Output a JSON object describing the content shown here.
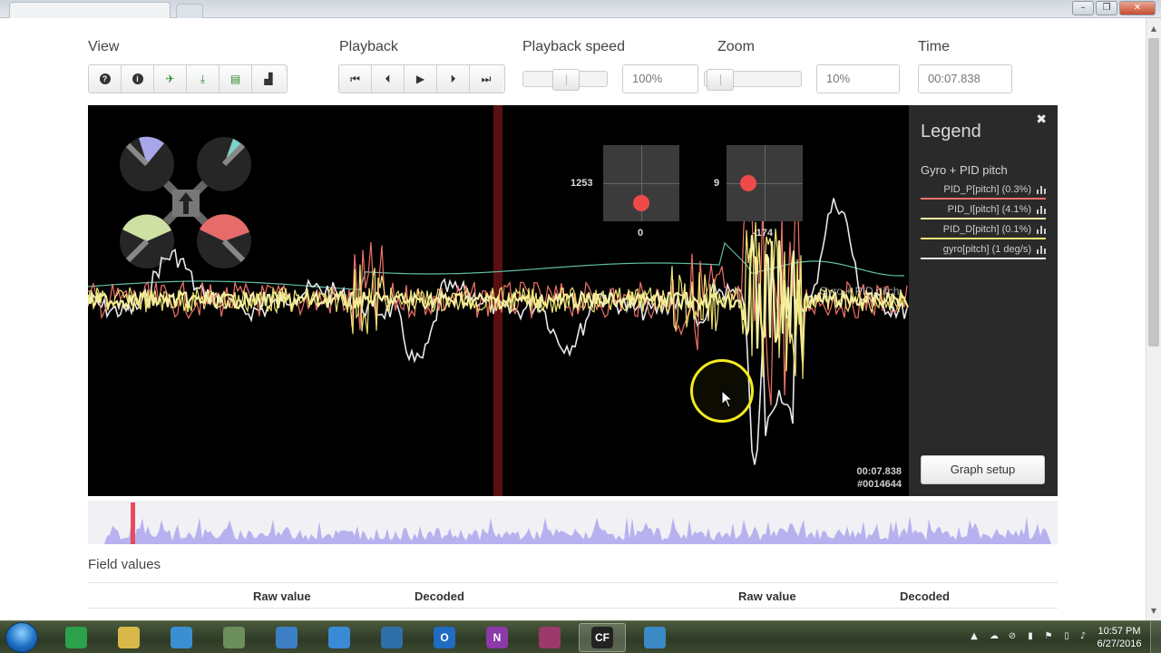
{
  "window": {
    "minimize_glyph": "–",
    "maximize_glyph": "❐",
    "close_glyph": "✕"
  },
  "toolbar": {
    "view_label": "View",
    "playback_label": "Playback",
    "playback_speed_label": "Playback speed",
    "zoom_label": "Zoom",
    "time_label": "Time",
    "view_buttons": [
      {
        "icon": "help-icon",
        "glyph": "?"
      },
      {
        "icon": "info-icon",
        "glyph": "i"
      },
      {
        "icon": "aircraft-icon",
        "glyph": "✈"
      },
      {
        "icon": "download-icon",
        "glyph": "⤓"
      },
      {
        "icon": "spreadsheet-icon",
        "glyph": "▤"
      },
      {
        "icon": "histogram-icon",
        "glyph": "▟"
      }
    ],
    "playback_buttons": [
      {
        "icon": "skip-start-icon",
        "glyph": "⏮"
      },
      {
        "icon": "step-back-icon",
        "glyph": "⏴"
      },
      {
        "icon": "play-icon",
        "glyph": "▶"
      },
      {
        "icon": "step-forward-icon",
        "glyph": "⏵"
      },
      {
        "icon": "skip-end-icon",
        "glyph": "⏭"
      }
    ],
    "playback_speed_value": "100%",
    "zoom_value": "10%",
    "time_value": "00:07.838"
  },
  "graph": {
    "stick_left": {
      "left_value": "1253",
      "bottom_value": "0"
    },
    "stick_right": {
      "left_value": "9",
      "bottom_value": "-174"
    },
    "series_label": "Gyro + PID pitch",
    "time_readout": "00:07.838",
    "frame_readout": "#0014644",
    "colors": {
      "pid_p": "#f07268",
      "pid_i": "#f6f0a8",
      "pid_d": "#f0e678",
      "gyro": "#e8e8ec",
      "setpoint": "#5fbfa8",
      "cursor_line": "#8a1414"
    }
  },
  "legend": {
    "title": "Legend",
    "close_glyph": "✖",
    "group_title": "Gyro + PID pitch",
    "items": [
      {
        "label": "PID_P[pitch] (0.3%)",
        "color": "#f07268"
      },
      {
        "label": "PID_I[pitch] (4.1%)",
        "color": "#f6f0a8"
      },
      {
        "label": "PID_D[pitch] (0.1%)",
        "color": "#f0e678"
      },
      {
        "label": "gyro[pitch] (1 deg/s)",
        "color": "#e8e8ec"
      }
    ],
    "graph_setup_label": "Graph setup"
  },
  "field_values": {
    "title": "Field values",
    "raw_value_header": "Raw value",
    "decoded_header": "Decoded"
  },
  "taskbar": {
    "apps": [
      {
        "name": "chrome",
        "label": "",
        "color": "#2aa14a"
      },
      {
        "name": "explorer",
        "label": "",
        "color": "#d9b84a"
      },
      {
        "name": "browser-globe",
        "label": "",
        "color": "#3a8fd0"
      },
      {
        "name": "control-panel",
        "label": "",
        "color": "#6b8e5a"
      },
      {
        "name": "chart-app",
        "label": "",
        "color": "#3c7fc5"
      },
      {
        "name": "book-app",
        "label": "",
        "color": "#3a8ad6"
      },
      {
        "name": "signal-app",
        "label": "",
        "color": "#2f6fa8"
      },
      {
        "name": "outlook",
        "label": "O",
        "color": "#1f6cc2"
      },
      {
        "name": "onenote",
        "label": "N",
        "color": "#8b3aa8"
      },
      {
        "name": "winrar",
        "label": "",
        "color": "#9b3a6a"
      },
      {
        "name": "cleanflight-log",
        "label": "CF",
        "color": "#222222"
      },
      {
        "name": "media-app",
        "label": "",
        "color": "#3a8ac6"
      }
    ],
    "time": "10:57 PM",
    "date": "6/27/2016"
  }
}
